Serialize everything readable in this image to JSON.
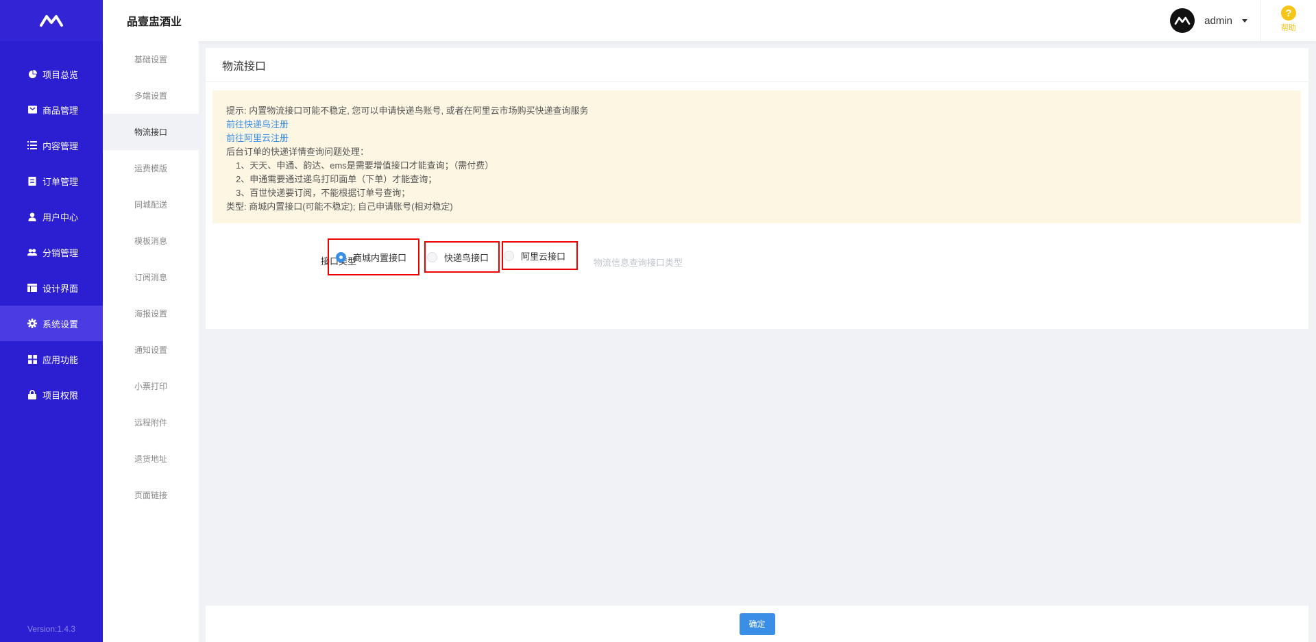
{
  "app": {
    "brand": "品壹盅酒业",
    "version": "Version:1.4.3"
  },
  "user": {
    "name": "admin"
  },
  "help": {
    "label": "帮助"
  },
  "sidebar": {
    "items": [
      {
        "label": "项目总览",
        "icon": "pie-chart-icon"
      },
      {
        "label": "商品管理",
        "icon": "box-icon"
      },
      {
        "label": "内容管理",
        "icon": "list-icon"
      },
      {
        "label": "订单管理",
        "icon": "order-icon"
      },
      {
        "label": "用户中心",
        "icon": "user-icon"
      },
      {
        "label": "分销管理",
        "icon": "users-icon"
      },
      {
        "label": "设计界面",
        "icon": "layout-icon"
      },
      {
        "label": "系统设置",
        "icon": "gear-icon",
        "active": true
      },
      {
        "label": "应用功能",
        "icon": "grid-icon"
      },
      {
        "label": "项目权限",
        "icon": "lock-icon"
      }
    ]
  },
  "subnav": {
    "items": [
      "基础设置",
      "多端设置",
      "物流接口",
      "运费模版",
      "同城配送",
      "模板消息",
      "订阅消息",
      "海报设置",
      "通知设置",
      "小票打印",
      "远程附件",
      "退货地址",
      "页面链接"
    ],
    "active_index": 2
  },
  "page": {
    "title": "物流接口",
    "notice": {
      "line1": "提示: 内置物流接口可能不稳定, 您可以申请快递鸟账号, 或者在阿里云市场购买快递查询服务",
      "link1": "前往快递鸟注册",
      "link2": "前往阿里云注册",
      "line2": "后台订单的快递详情查询问题处理：",
      "item1": "1、天天、申通、韵达、ems是需要增值接口才能查询；（需付费）",
      "item2": "2、申通需要通过递鸟打印面单（下单）才能查询；",
      "item3": "3、百世快递要订阅，不能根据订单号查询；",
      "line3": "类型: 商城内置接口(可能不稳定); 自己申请账号(相对稳定)"
    },
    "form": {
      "label": "接口类型",
      "options": [
        "商城内置接口",
        "快递鸟接口",
        "阿里云接口"
      ],
      "selected": 0,
      "hint": "物流信息查询接口类型"
    },
    "submit_label": "确定"
  },
  "colors": {
    "sidebar": "#2c1fd1",
    "accent": "#3a8ee6",
    "highlight_border": "#e00000"
  }
}
